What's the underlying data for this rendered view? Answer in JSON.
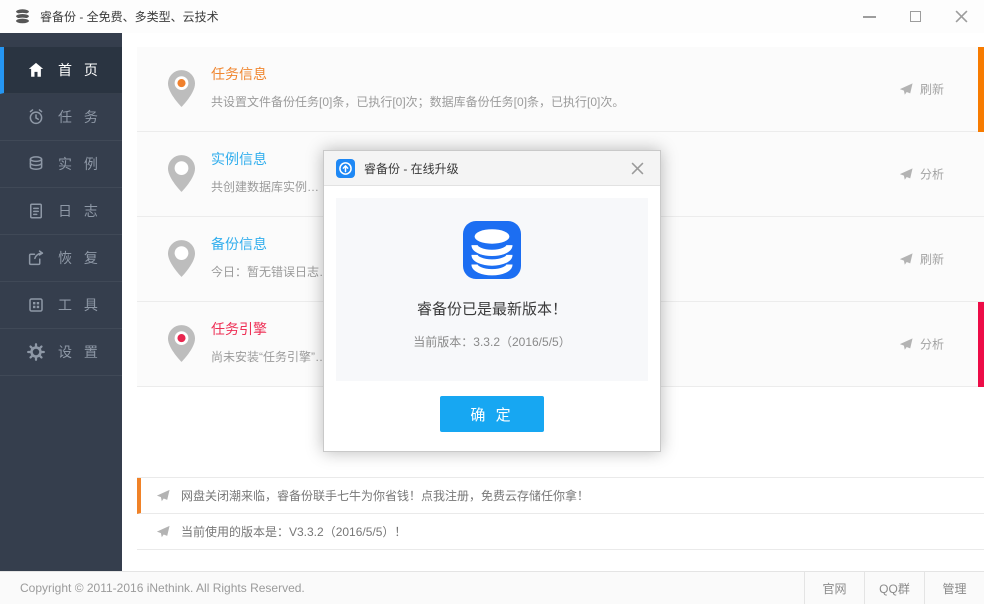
{
  "window": {
    "title": "睿备份 - 全免费、多类型、云技术",
    "app_icon": "database-stack-icon"
  },
  "sidebar": {
    "items": [
      {
        "label": "首 页",
        "icon": "home-icon",
        "active": true
      },
      {
        "label": "任 务",
        "icon": "alarm-clock-icon",
        "active": false
      },
      {
        "label": "实 例",
        "icon": "database-icon",
        "active": false
      },
      {
        "label": "日 志",
        "icon": "log-document-icon",
        "active": false
      },
      {
        "label": "恢 复",
        "icon": "restore-share-icon",
        "active": false
      },
      {
        "label": "工 具",
        "icon": "tools-grid-icon",
        "active": false
      },
      {
        "label": "设 置",
        "icon": "gear-icon",
        "active": false
      }
    ]
  },
  "rows": [
    {
      "title": "任务信息",
      "subtitle": "共设置文件备份任务[0]条，已执行[0]次；数据库备份任务[0]条，已执行[0]次。",
      "action": "刷新",
      "pin_dot": "#f0802c",
      "accent": "#f77b00"
    },
    {
      "title": "实例信息",
      "subtitle": "共创建数据库实例…",
      "action": "分析",
      "pin_dot": "",
      "accent": ""
    },
    {
      "title": "备份信息",
      "subtitle": "今日：暂无错误日志…",
      "action": "刷新",
      "pin_dot": "",
      "accent": ""
    },
    {
      "title": "任务引擎",
      "subtitle": "尚未安装“任务引擎”…！",
      "action": "分析",
      "pin_dot": "#e8274f",
      "accent": "#ed0c47"
    }
  ],
  "notices": [
    {
      "text": "网盘关闭潮来临，睿备份联手七牛为你省钱！点我注册，免费云存储任你拿！",
      "accent": "#f08228"
    },
    {
      "text": "当前使用的版本是：V3.3.2（2016/5/5）！",
      "accent": ""
    }
  ],
  "dialog": {
    "title": "睿备份 - 在线升级",
    "icon": "upgrade-arrow-icon",
    "message": "睿备份已是最新版本！",
    "version": "当前版本：3.3.2（2016/5/5）",
    "ok_label": "确 定"
  },
  "footer": {
    "copyright": "Copyright © 2011-2016 iNethink. All Rights Reserved.",
    "links": [
      "官网",
      "QQ群",
      "管理"
    ]
  },
  "colors": {
    "sidebar_bg": "#353e4d",
    "sidebar_active_bg": "#2a3441",
    "sidebar_active_accent": "#2596f3",
    "row_title_orange": "#f0862f",
    "row_title_blue": "#31aeed",
    "row_title_red": "#ee2f55",
    "row_accent_orange": "#f77b00",
    "row_accent_red": "#ed0c47",
    "notice_accent_orange": "#f08228",
    "dialog_button_blue": "#17a7f2",
    "dialog_icon_blue": "#1c6ef2"
  }
}
